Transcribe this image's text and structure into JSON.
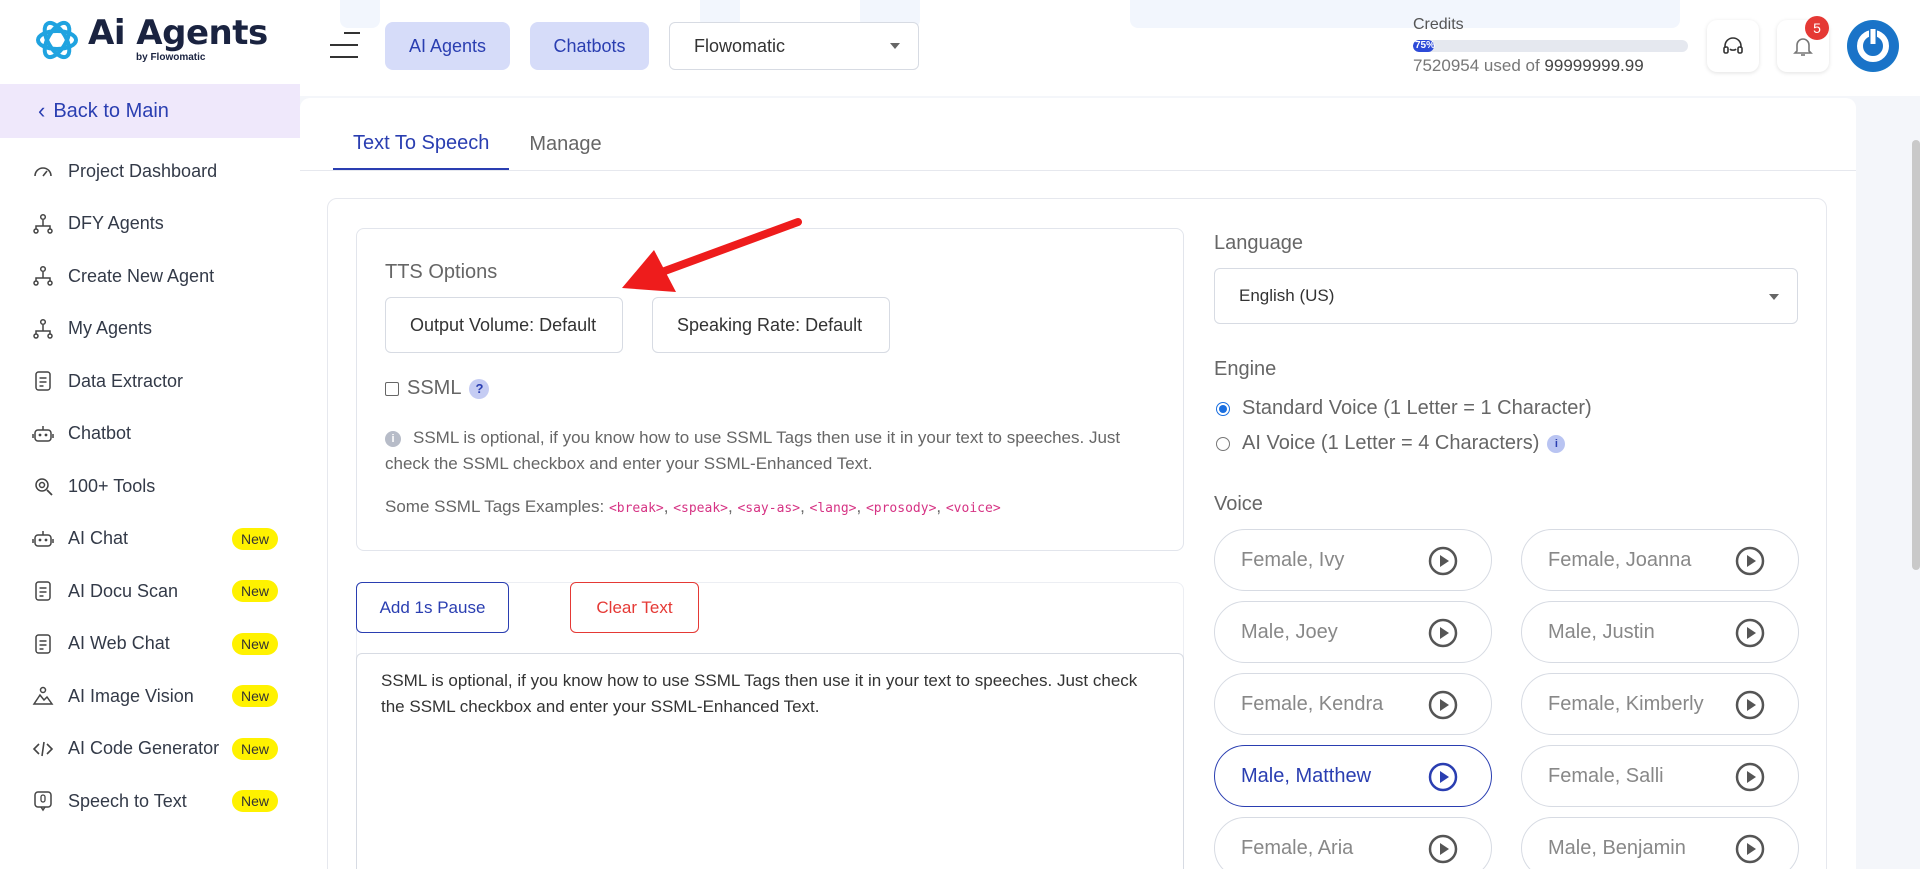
{
  "brand": {
    "title": "Ai Agents",
    "subtitle": "by Flowomatic"
  },
  "sidebar": {
    "back": "Back to Main",
    "items": [
      {
        "label": "Project Dashboard",
        "icon": "gauge-icon",
        "badge": ""
      },
      {
        "label": "DFY Agents",
        "icon": "agent-tree-icon",
        "badge": ""
      },
      {
        "label": "Create New Agent",
        "icon": "agent-tree-icon",
        "badge": ""
      },
      {
        "label": "My Agents",
        "icon": "agent-tree-icon",
        "badge": ""
      },
      {
        "label": "Data Extractor",
        "icon": "document-icon",
        "badge": ""
      },
      {
        "label": "Chatbot",
        "icon": "robot-icon",
        "badge": ""
      },
      {
        "label": "100+ Tools",
        "icon": "tools-gear-icon",
        "badge": ""
      },
      {
        "label": "AI Chat",
        "icon": "robot-icon",
        "badge": "New"
      },
      {
        "label": "AI Docu Scan",
        "icon": "document-icon",
        "badge": "New"
      },
      {
        "label": "AI Web Chat",
        "icon": "document-icon",
        "badge": "New"
      },
      {
        "label": "AI Image Vision",
        "icon": "image-vision-icon",
        "badge": "New"
      },
      {
        "label": "AI Code Generator",
        "icon": "code-icon",
        "badge": "New"
      },
      {
        "label": "Speech to Text",
        "icon": "speech-icon",
        "badge": "New"
      }
    ]
  },
  "header": {
    "btn_agents": "AI Agents",
    "btn_chatbots": "Chatbots",
    "workspace": "Flowomatic",
    "credits_label": "Credits",
    "credits_percent": "75%",
    "credits_fraction": 0.0752,
    "credits_used": "7520954",
    "credits_used_of": "used of",
    "credits_total": "99999999.99",
    "notif_count": "5"
  },
  "tabs": {
    "tts": "Text To Speech",
    "manage": "Manage"
  },
  "tts": {
    "title": "TTS Options",
    "output_volume": "Output Volume: Default",
    "speaking_rate": "Speaking Rate: Default",
    "ssml_label": "SSML",
    "ssml_help": "?",
    "info": "SSML is optional, if you know how to use SSML Tags then use it in your text to speeches. Just check the SSML checkbox and enter your SSML-Enhanced Text.",
    "tags_prefix": "Some SSML Tags Examples:",
    "tags": [
      "<break>",
      "<speak>",
      "<say-as>",
      "<lang>",
      "<prosody>",
      "<voice>"
    ]
  },
  "actions": {
    "add_pause": "Add 1s Pause",
    "clear_text": "Clear Text"
  },
  "editor": {
    "text": " SSML is optional, if you know how to use SSML Tags then use it in your text to speeches. Just check the SSML checkbox and enter your SSML-Enhanced Text."
  },
  "language": {
    "label": "Language",
    "value": "English (US)"
  },
  "engine": {
    "label": "Engine",
    "standard": "Standard Voice (1 Letter = 1 Character)",
    "ai": "AI Voice (1 Letter = 4 Characters)",
    "selected": "standard"
  },
  "voice": {
    "label": "Voice",
    "selected": "Male, Matthew",
    "options": [
      "Female, Ivy",
      "Female, Joanna",
      "Male, Joey",
      "Male, Justin",
      "Female, Kendra",
      "Female, Kimberly",
      "Male, Matthew",
      "Female, Salli",
      "Female, Aria",
      "Male, Benjamin"
    ]
  },
  "colors": {
    "accent": "#2a3eb1",
    "badge": "#fff200",
    "danger": "#e53935",
    "annotation_arrow": "#ee1c1c"
  }
}
